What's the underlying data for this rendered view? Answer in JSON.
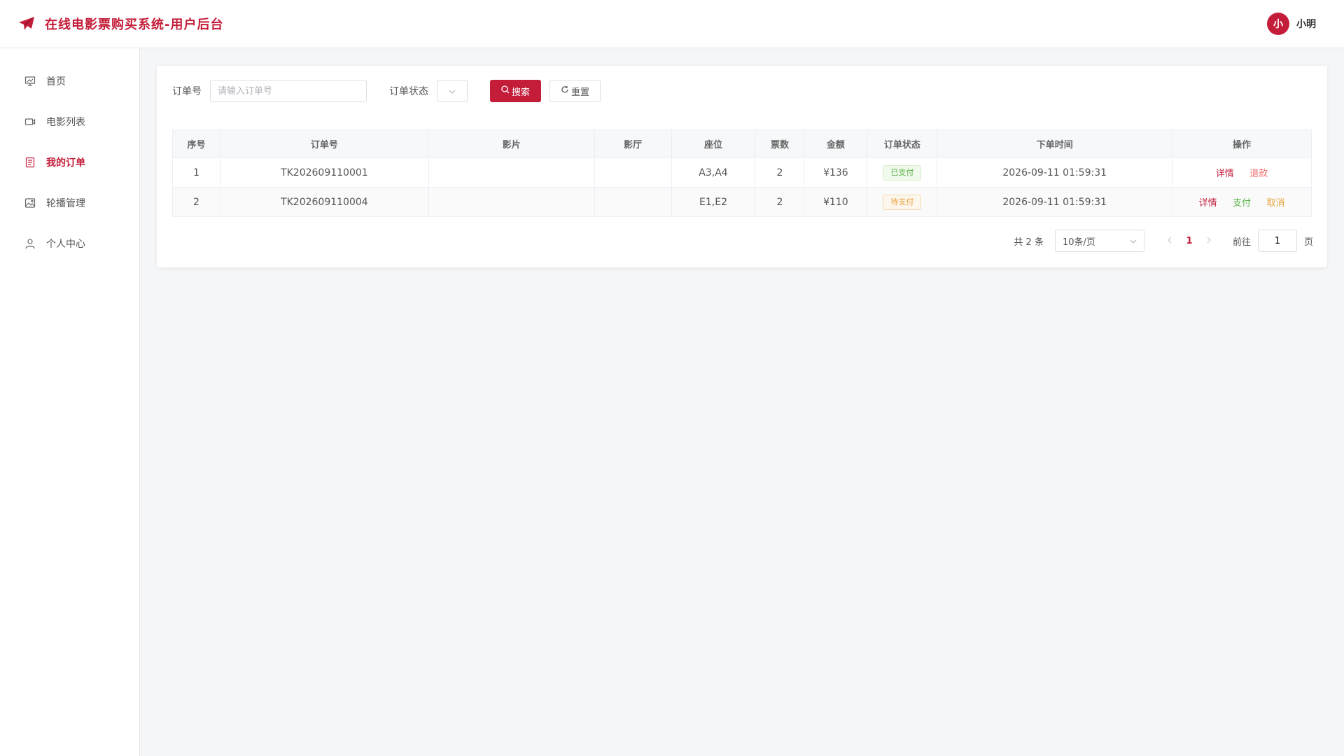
{
  "header": {
    "title": "在线电影票购买系统-用户后台",
    "user_initial": "小",
    "user_name": "小明"
  },
  "sidebar": {
    "items": [
      {
        "label": "首页",
        "icon": "presentation-icon",
        "active": false
      },
      {
        "label": "电影列表",
        "icon": "video-camera-icon",
        "active": false
      },
      {
        "label": "我的订单",
        "icon": "document-icon",
        "active": true
      },
      {
        "label": "轮播管理",
        "icon": "image-icon",
        "active": false
      },
      {
        "label": "个人中心",
        "icon": "user-icon",
        "active": false
      }
    ]
  },
  "filter": {
    "order_no_label": "订单号",
    "order_no_placeholder": "请输入订单号",
    "status_label": "订单状态",
    "search_label": "搜索",
    "reset_label": "重置"
  },
  "table": {
    "columns": [
      "序号",
      "订单号",
      "影片",
      "影厅",
      "座位",
      "票数",
      "金额",
      "订单状态",
      "下单时间",
      "操作"
    ],
    "rows": [
      {
        "index": "1",
        "order_no": "TK202609110001",
        "movie": "",
        "hall": "",
        "seats": "A3,A4",
        "count": "2",
        "amount": "¥136",
        "status": "已支付",
        "time": "2026-09-11 01:59:31",
        "actions": [
          "详情",
          "退款"
        ]
      },
      {
        "index": "2",
        "order_no": "TK202609110004",
        "movie": "",
        "hall": "",
        "seats": "E1,E2",
        "count": "2",
        "amount": "¥110",
        "status": "待支付",
        "time": "2026-09-11 01:59:31",
        "actions": [
          "详情",
          "支付",
          "取消"
        ]
      }
    ]
  },
  "pagination": {
    "total": "共 2 条",
    "page_size": "10条/页",
    "current_page": "1",
    "goto_label": "前往",
    "goto_value": "1",
    "page_suffix": "页"
  },
  "colors": {
    "brand": "#c41d3a",
    "success": "#52b03f",
    "warning": "#e6a23c"
  }
}
